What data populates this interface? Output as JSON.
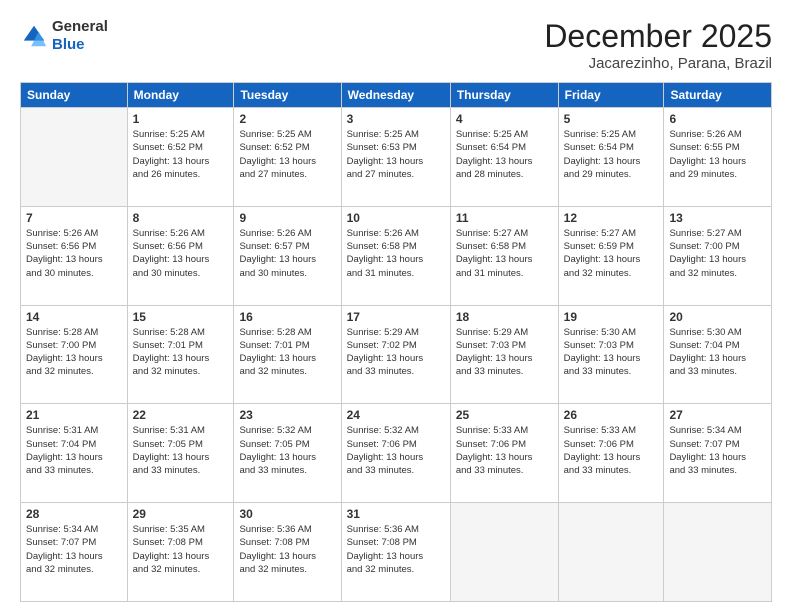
{
  "header": {
    "logo": {
      "line1": "General",
      "line2": "Blue"
    },
    "title": "December 2025",
    "location": "Jacarezinho, Parana, Brazil"
  },
  "weekdays": [
    "Sunday",
    "Monday",
    "Tuesday",
    "Wednesday",
    "Thursday",
    "Friday",
    "Saturday"
  ],
  "weeks": [
    [
      {
        "day": "",
        "info": ""
      },
      {
        "day": "1",
        "info": "Sunrise: 5:25 AM\nSunset: 6:52 PM\nDaylight: 13 hours\nand 26 minutes."
      },
      {
        "day": "2",
        "info": "Sunrise: 5:25 AM\nSunset: 6:52 PM\nDaylight: 13 hours\nand 27 minutes."
      },
      {
        "day": "3",
        "info": "Sunrise: 5:25 AM\nSunset: 6:53 PM\nDaylight: 13 hours\nand 27 minutes."
      },
      {
        "day": "4",
        "info": "Sunrise: 5:25 AM\nSunset: 6:54 PM\nDaylight: 13 hours\nand 28 minutes."
      },
      {
        "day": "5",
        "info": "Sunrise: 5:25 AM\nSunset: 6:54 PM\nDaylight: 13 hours\nand 29 minutes."
      },
      {
        "day": "6",
        "info": "Sunrise: 5:26 AM\nSunset: 6:55 PM\nDaylight: 13 hours\nand 29 minutes."
      }
    ],
    [
      {
        "day": "7",
        "info": "Sunrise: 5:26 AM\nSunset: 6:56 PM\nDaylight: 13 hours\nand 30 minutes."
      },
      {
        "day": "8",
        "info": "Sunrise: 5:26 AM\nSunset: 6:56 PM\nDaylight: 13 hours\nand 30 minutes."
      },
      {
        "day": "9",
        "info": "Sunrise: 5:26 AM\nSunset: 6:57 PM\nDaylight: 13 hours\nand 30 minutes."
      },
      {
        "day": "10",
        "info": "Sunrise: 5:26 AM\nSunset: 6:58 PM\nDaylight: 13 hours\nand 31 minutes."
      },
      {
        "day": "11",
        "info": "Sunrise: 5:27 AM\nSunset: 6:58 PM\nDaylight: 13 hours\nand 31 minutes."
      },
      {
        "day": "12",
        "info": "Sunrise: 5:27 AM\nSunset: 6:59 PM\nDaylight: 13 hours\nand 32 minutes."
      },
      {
        "day": "13",
        "info": "Sunrise: 5:27 AM\nSunset: 7:00 PM\nDaylight: 13 hours\nand 32 minutes."
      }
    ],
    [
      {
        "day": "14",
        "info": "Sunrise: 5:28 AM\nSunset: 7:00 PM\nDaylight: 13 hours\nand 32 minutes."
      },
      {
        "day": "15",
        "info": "Sunrise: 5:28 AM\nSunset: 7:01 PM\nDaylight: 13 hours\nand 32 minutes."
      },
      {
        "day": "16",
        "info": "Sunrise: 5:28 AM\nSunset: 7:01 PM\nDaylight: 13 hours\nand 32 minutes."
      },
      {
        "day": "17",
        "info": "Sunrise: 5:29 AM\nSunset: 7:02 PM\nDaylight: 13 hours\nand 33 minutes."
      },
      {
        "day": "18",
        "info": "Sunrise: 5:29 AM\nSunset: 7:03 PM\nDaylight: 13 hours\nand 33 minutes."
      },
      {
        "day": "19",
        "info": "Sunrise: 5:30 AM\nSunset: 7:03 PM\nDaylight: 13 hours\nand 33 minutes."
      },
      {
        "day": "20",
        "info": "Sunrise: 5:30 AM\nSunset: 7:04 PM\nDaylight: 13 hours\nand 33 minutes."
      }
    ],
    [
      {
        "day": "21",
        "info": "Sunrise: 5:31 AM\nSunset: 7:04 PM\nDaylight: 13 hours\nand 33 minutes."
      },
      {
        "day": "22",
        "info": "Sunrise: 5:31 AM\nSunset: 7:05 PM\nDaylight: 13 hours\nand 33 minutes."
      },
      {
        "day": "23",
        "info": "Sunrise: 5:32 AM\nSunset: 7:05 PM\nDaylight: 13 hours\nand 33 minutes."
      },
      {
        "day": "24",
        "info": "Sunrise: 5:32 AM\nSunset: 7:06 PM\nDaylight: 13 hours\nand 33 minutes."
      },
      {
        "day": "25",
        "info": "Sunrise: 5:33 AM\nSunset: 7:06 PM\nDaylight: 13 hours\nand 33 minutes."
      },
      {
        "day": "26",
        "info": "Sunrise: 5:33 AM\nSunset: 7:06 PM\nDaylight: 13 hours\nand 33 minutes."
      },
      {
        "day": "27",
        "info": "Sunrise: 5:34 AM\nSunset: 7:07 PM\nDaylight: 13 hours\nand 33 minutes."
      }
    ],
    [
      {
        "day": "28",
        "info": "Sunrise: 5:34 AM\nSunset: 7:07 PM\nDaylight: 13 hours\nand 32 minutes."
      },
      {
        "day": "29",
        "info": "Sunrise: 5:35 AM\nSunset: 7:08 PM\nDaylight: 13 hours\nand 32 minutes."
      },
      {
        "day": "30",
        "info": "Sunrise: 5:36 AM\nSunset: 7:08 PM\nDaylight: 13 hours\nand 32 minutes."
      },
      {
        "day": "31",
        "info": "Sunrise: 5:36 AM\nSunset: 7:08 PM\nDaylight: 13 hours\nand 32 minutes."
      },
      {
        "day": "",
        "info": ""
      },
      {
        "day": "",
        "info": ""
      },
      {
        "day": "",
        "info": ""
      }
    ]
  ]
}
